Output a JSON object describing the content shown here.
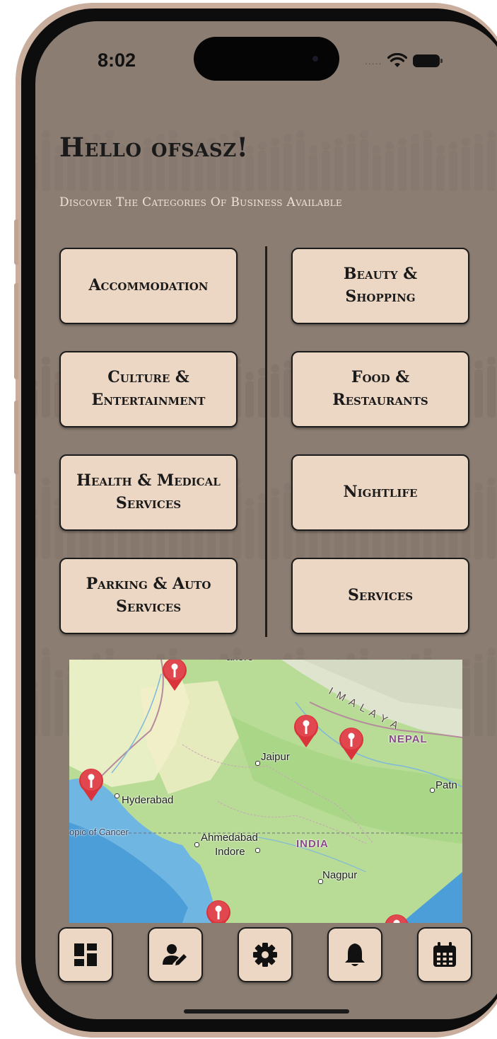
{
  "status_bar": {
    "time": "8:02",
    "cell_dots": "....."
  },
  "greeting": "Hello ofsasz!",
  "subtitle": "Discover The Categories Of Business Available",
  "categories": {
    "left": [
      {
        "line1": "Accommodation",
        "line2": ""
      },
      {
        "line1": "Culture &",
        "line2": "Entertainment"
      },
      {
        "line1": "Health & Medical",
        "line2": "Services"
      },
      {
        "line1": "Parking & Auto",
        "line2": "Services"
      }
    ],
    "right": [
      {
        "line1": "Beauty &",
        "line2": "Shopping"
      },
      {
        "line1": "Food &",
        "line2": "Restaurants"
      },
      {
        "line1": "Nightlife",
        "line2": ""
      },
      {
        "line1": "Services",
        "line2": ""
      }
    ]
  },
  "map": {
    "labels": {
      "jaipur": "Jaipur",
      "nepal": "NEPAL",
      "patna": "Patn",
      "hyderabad": "Hyderabad",
      "tropic": "opic of Cancer",
      "ahmedabad": "Ahmedabad",
      "indore": "Indore",
      "india": "INDIA",
      "nagpur": "Nagpur",
      "lahore": "ahore",
      "himalaya": "I M A L A Y A"
    }
  },
  "tab_bar": {
    "icons": [
      "dashboard-icon",
      "edit-user-icon",
      "gear-icon",
      "bell-icon",
      "calendar-icon"
    ]
  },
  "colors": {
    "screen_bg": "#8b7d72",
    "button_bg": "#ecd6c4",
    "button_border": "#1c1c1c",
    "pin_red": "#d9343b"
  }
}
